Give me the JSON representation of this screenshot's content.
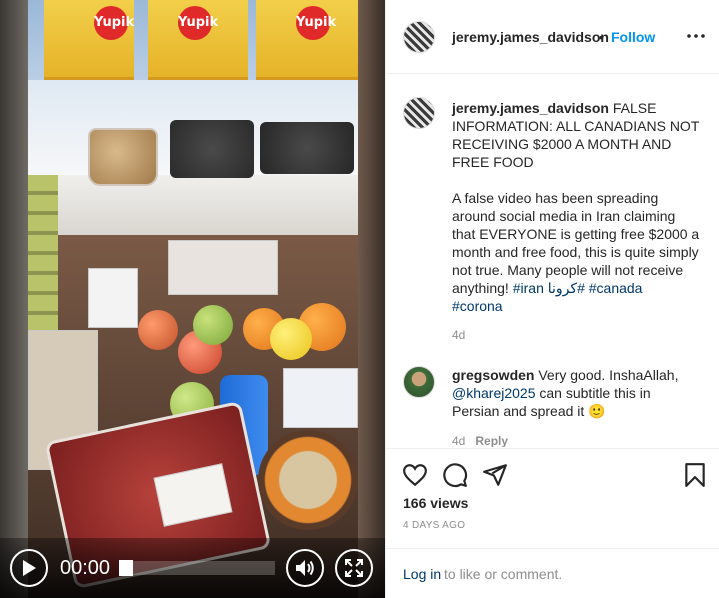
{
  "video": {
    "current_time": "00:00",
    "progress": 0,
    "snack_brand": "Yupik"
  },
  "post": {
    "username": "jeremy.james_davidson",
    "separator": "•",
    "follow_label": "Follow",
    "caption": {
      "username": "jeremy.james_davidson",
      "text": "FALSE INFORMATION: ALL CANADIANS NOT RECEIVING $2000 A MONTH AND FREE FOOD\n\nA false video has been spreading around social media in Iran claiming that EVERYONE is getting free $2000 a month and free food, this is quite simply not true. Many people will not receive anything! ",
      "hashtags": [
        "#iran",
        "#كرونا",
        "#canada",
        "#corona"
      ],
      "age": "4d"
    },
    "comments": [
      {
        "username": "gregsowden",
        "text_before": "Very good. InshaAllah, ",
        "mention": "@kharej2025",
        "text_after": " can subtitle this in Persian and spread it 🙂",
        "age": "4d",
        "reply_label": "Reply"
      }
    ],
    "views": "166 views",
    "time_ago": "4 DAYS AGO",
    "login_link": "Log in",
    "login_rest": "to like or comment."
  },
  "colors": {
    "follow_blue": "#0095f6",
    "link_blue": "#00376b",
    "muted_gray": "#8e8e8e",
    "text_dark": "#262626"
  },
  "icons": {
    "more": "more-horizontal-icon",
    "like": "heart-icon",
    "comment": "comment-bubble-icon",
    "share": "paper-plane-icon",
    "save": "bookmark-icon",
    "play": "play-icon",
    "volume": "volume-icon",
    "fullscreen": "fullscreen-icon"
  }
}
